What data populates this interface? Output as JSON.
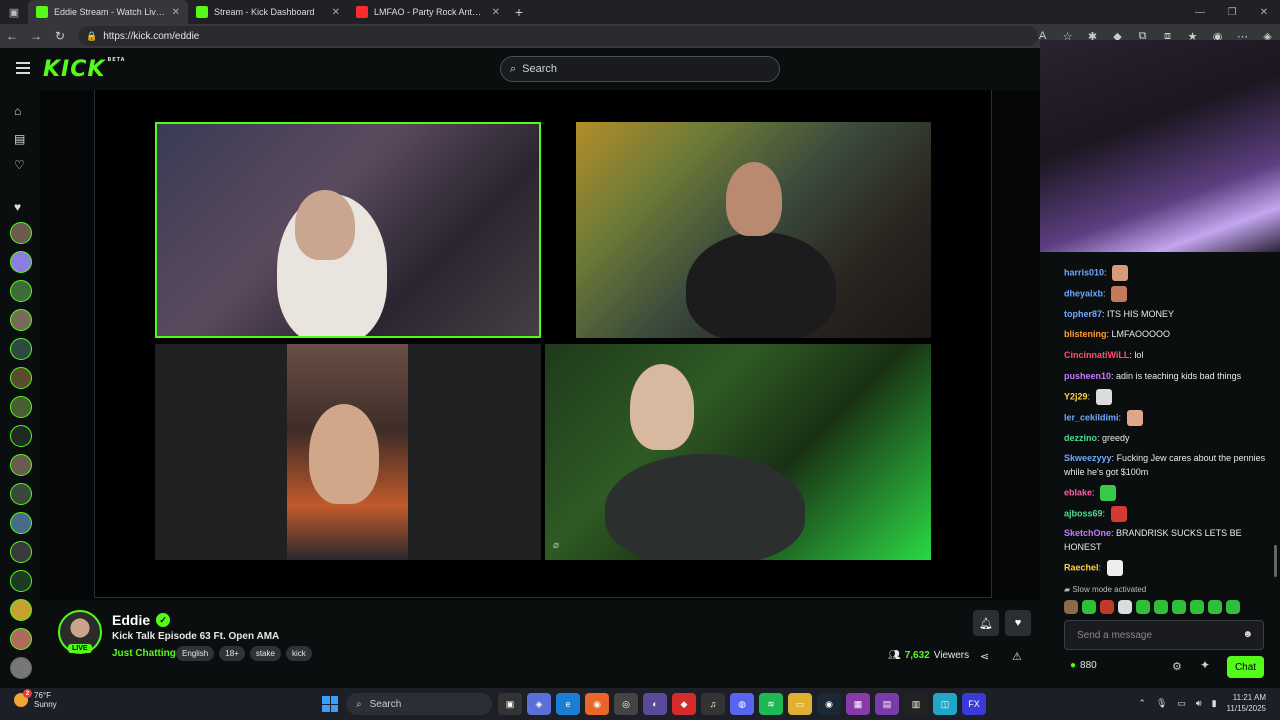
{
  "browser": {
    "tabs": [
      {
        "title": "Eddie Stream - Watch Live o",
        "favicon": "kick-icon"
      },
      {
        "title": "Stream - Kick Dashboard",
        "favicon": "kick-icon"
      },
      {
        "title": "LMFAO - Party Rock Anthem ft. L",
        "favicon": "youtube-icon"
      }
    ],
    "url": "https://kick.com/eddie"
  },
  "header": {
    "logo": "KICK",
    "logo_badge": "BETA",
    "search_placeholder": "Search"
  },
  "stream": {
    "streamer": "Eddie",
    "live_badge": "LIVE",
    "title": "Kick Talk Episode 63 Ft. Open AMA",
    "category": "Just Chatting",
    "tags": [
      "English",
      "18+",
      "stake",
      "kick"
    ],
    "viewers": "7,632",
    "viewers_label": "Viewers"
  },
  "chat": {
    "messages": [
      {
        "user": "harris010",
        "color": "#6fa8ff",
        "text": "",
        "emote": "#d89a7a"
      },
      {
        "user": "dheyaixb",
        "color": "#6fa8ff",
        "text": "",
        "emote": "#c47a5a"
      },
      {
        "user": "topher87",
        "color": "#6fa8ff",
        "text": "ITS HIS MONEY"
      },
      {
        "user": "blistening",
        "color": "#ff9b2f",
        "text": "LMFAOOOOO"
      },
      {
        "user": "CincinnatiWiLL",
        "color": "#ff4d6d",
        "text": "lol"
      },
      {
        "user": "pusheen10",
        "color": "#c17bff",
        "text": "adin is teaching kids bad things"
      },
      {
        "user": "Y2j29",
        "color": "#ffd24d",
        "text": "",
        "emote": "#dcdcdc"
      },
      {
        "user": "ler_cekildimi",
        "color": "#6fa8ff",
        "text": "",
        "emote": "#e0a58b"
      },
      {
        "user": "dezzino",
        "color": "#4ddc8f",
        "text": "greedy"
      },
      {
        "user": "Skweezyyy",
        "color": "#6fa8ff",
        "text": "Fucking Jew cares about the pennies while he's got $100m"
      },
      {
        "user": "eblake",
        "color": "#ff5fa8",
        "text": "",
        "emote": "#37c94a"
      },
      {
        "user": "ajboss69",
        "color": "#4ddc8f",
        "text": "",
        "emote": "#d33b2f"
      },
      {
        "user": "SketchOne",
        "color": "#c17bff",
        "text": "BRANDRISK SUCKS LETS BE HONEST"
      },
      {
        "user": "Raechel",
        "color": "#ffd24d",
        "text": "",
        "emote": "#eeeeee"
      }
    ],
    "slow_mode": "Slow mode activated",
    "input_placeholder": "Send a message",
    "points": "880",
    "send_label": "Chat"
  },
  "taskbar": {
    "temp": "76°F",
    "weather": "Sunny",
    "weather_badge": "2",
    "search_placeholder": "Search",
    "time": "11:21 AM",
    "date": "11/15/2025"
  },
  "colors": {
    "accent": "#53fc18"
  }
}
